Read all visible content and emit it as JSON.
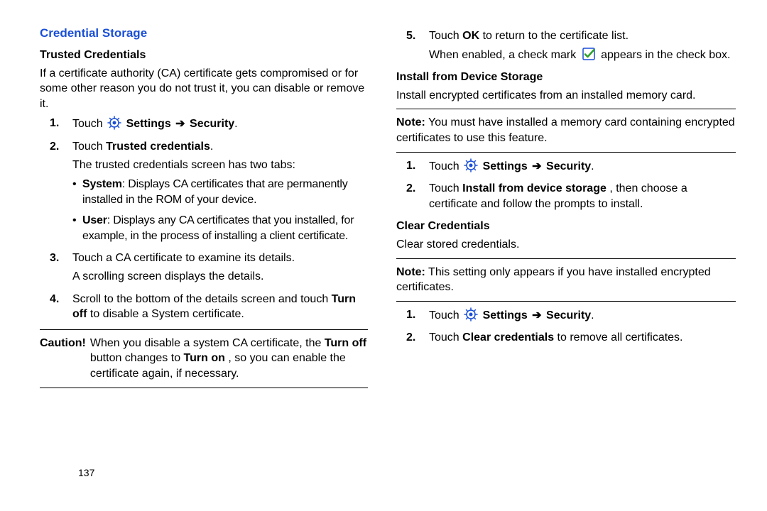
{
  "page_number": "137",
  "left": {
    "section_title": "Credential Storage",
    "sub1": "Trusted Credentials",
    "intro": "If a certificate authority (CA) certificate gets compromised or for some other reason you do not trust it, you can disable or remove it.",
    "step1_a": "Touch ",
    "step1_b": "Settings",
    "step1_c": "Security",
    "step2_a": "Touch ",
    "step2_b": "Trusted credentials",
    "step2_after": "The trusted credentials screen has two tabs:",
    "bullet1_a": "System",
    "bullet1_b": ": Displays CA certificates that are permanently installed in the ROM of your device.",
    "bullet2_a": "User",
    "bullet2_b": ": Displays any CA certificates that you installed, for example, in the process of installing a client certificate.",
    "step3_a": "Touch a CA certificate to examine its details.",
    "step3_b": "A scrolling screen displays the details.",
    "step4_a": "Scroll to the bottom of the details screen and touch ",
    "step4_b": "Turn off",
    "step4_c": " to disable a System certificate.",
    "caution_lead": "Caution!",
    "caution_a": "When you disable a system CA certificate, the ",
    "caution_b": "Turn off",
    "caution_c": " button changes to ",
    "caution_d": "Turn on",
    "caution_e": ", so you can enable the certificate again, if necessary."
  },
  "right": {
    "step5_a": "Touch ",
    "step5_b": "OK",
    "step5_c": " to return to the certificate list.",
    "step5_after_a": "When enabled, a check mark ",
    "step5_after_b": " appears in the check box.",
    "sub2": "Install from Device Storage",
    "install_intro": "Install encrypted certificates from an installed memory card.",
    "note1_lead": "Note:",
    "note1_body": " You must have installed a memory card containing encrypted certificates to use this feature.",
    "istep1_a": "Touch ",
    "istep1_b": "Settings",
    "istep1_c": "Security",
    "istep2_a": "Touch ",
    "istep2_b": "Install from device storage",
    "istep2_c": ", then choose a certificate and follow the prompts to install.",
    "sub3": "Clear Credentials",
    "clear_intro": "Clear stored credentials.",
    "note2_lead": "Note:",
    "note2_body": " This setting only appears if you have installed encrypted certificates.",
    "cstep1_a": "Touch ",
    "cstep1_b": "Settings",
    "cstep1_c": "Security",
    "cstep2_a": "Touch ",
    "cstep2_b": "Clear credentials",
    "cstep2_c": " to remove all certificates."
  },
  "arrow": "➔"
}
